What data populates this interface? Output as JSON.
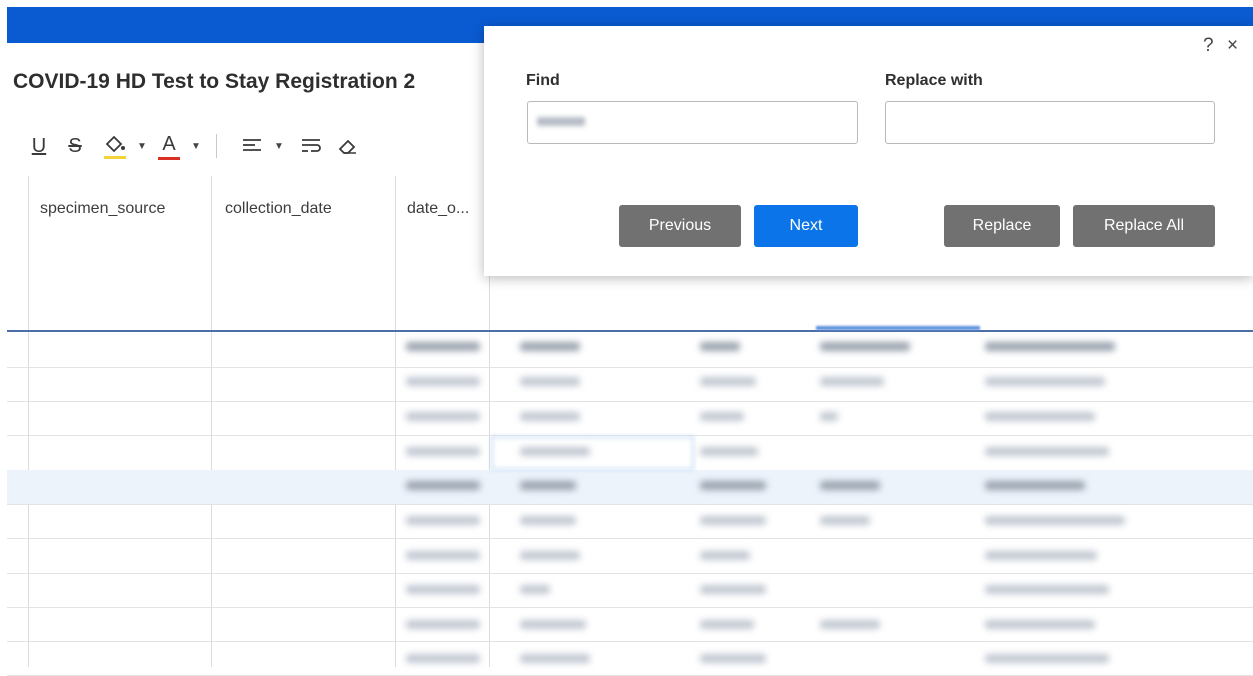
{
  "document": {
    "title": "COVID-19 HD Test to Stay Registration 2"
  },
  "toolbar": {
    "underline": "U",
    "strikethrough": "S",
    "font_color": "A",
    "fill_color_accent": "#f2d33a",
    "font_color_accent": "#d93025"
  },
  "grid": {
    "columns": [
      {
        "header": "specimen_source"
      },
      {
        "header": "collection_date"
      },
      {
        "header": "date_o..."
      }
    ]
  },
  "find_replace": {
    "find_label": "Find",
    "replace_label": "Replace with",
    "find_value": "",
    "replace_value": "",
    "help": "?",
    "close": "×",
    "buttons": {
      "previous": "Previous",
      "next": "Next",
      "replace": "Replace",
      "replace_all": "Replace All"
    }
  },
  "colors": {
    "app_bar": "#0a5bd2",
    "primary_button": "#0a74e8",
    "secondary_button": "#717171",
    "header_divider": "#4d6fa8"
  }
}
